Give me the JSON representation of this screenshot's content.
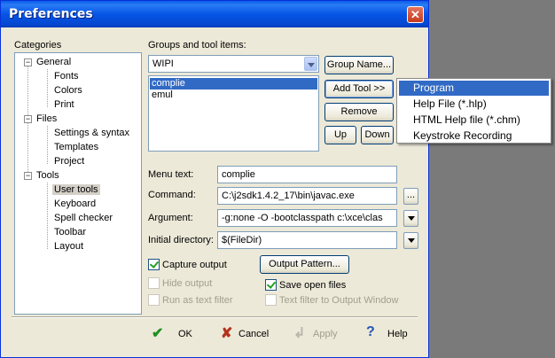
{
  "window": {
    "title": "Preferences",
    "close_glyph": "✕"
  },
  "categories": {
    "label": "Categories",
    "tree": [
      {
        "label": "General",
        "expander": "−",
        "children": [
          "Fonts",
          "Colors",
          "Print"
        ]
      },
      {
        "label": "Files",
        "expander": "−",
        "children": [
          "Settings & syntax",
          "Templates",
          "Project"
        ]
      },
      {
        "label": "Tools",
        "expander": "−",
        "children": [
          "User tools",
          "Keyboard",
          "Spell checker",
          "Toolbar",
          "Layout"
        ]
      }
    ],
    "selected": "User tools"
  },
  "groups": {
    "label": "Groups and tool items:",
    "combo_value": "WIPI",
    "items": [
      "complie",
      "emul"
    ],
    "selected_item": "complie",
    "group_name_button": "Group Name...",
    "add_tool_button": "Add Tool >>",
    "remove_button": "Remove",
    "up_button": "Up",
    "down_button": "Down"
  },
  "fields": {
    "menu_text_label": "Menu text:",
    "menu_text_value": "complie",
    "command_label": "Command:",
    "command_value": "C:\\j2sdk1.4.2_17\\bin\\javac.exe",
    "browse_label": "...",
    "argument_label": "Argument:",
    "argument_value": "-g:none -O -bootclasspath c:\\xce\\clas",
    "initial_dir_label": "Initial directory:",
    "initial_dir_value": "$(FileDir)"
  },
  "options": {
    "capture_output": "Capture output",
    "capture_output_checked": true,
    "output_pattern_button": "Output Pattern...",
    "hide_output": "Hide output",
    "save_open_files": "Save open files",
    "save_open_files_checked": true,
    "run_as_text_filter": "Run as text filter",
    "text_filter_to_output": "Text filter to Output Window"
  },
  "footer": {
    "ok": "OK",
    "cancel": "Cancel",
    "apply": "Apply",
    "help": "Help",
    "ok_icon": "checkmark-icon",
    "cancel_icon": "x-icon",
    "apply_icon": "apply-arrow-icon",
    "help_icon": "question-icon"
  },
  "add_tool_menu": {
    "items": [
      "Program",
      "Help File (*.hlp)",
      "HTML Help file (*.chm)",
      "Keystroke Recording"
    ],
    "highlighted": "Program"
  },
  "colors": {
    "title_bar": "#0655e5",
    "selection": "#316ac5",
    "close_button": "#c43b1e",
    "dialog_bg": "#ece9d8"
  }
}
